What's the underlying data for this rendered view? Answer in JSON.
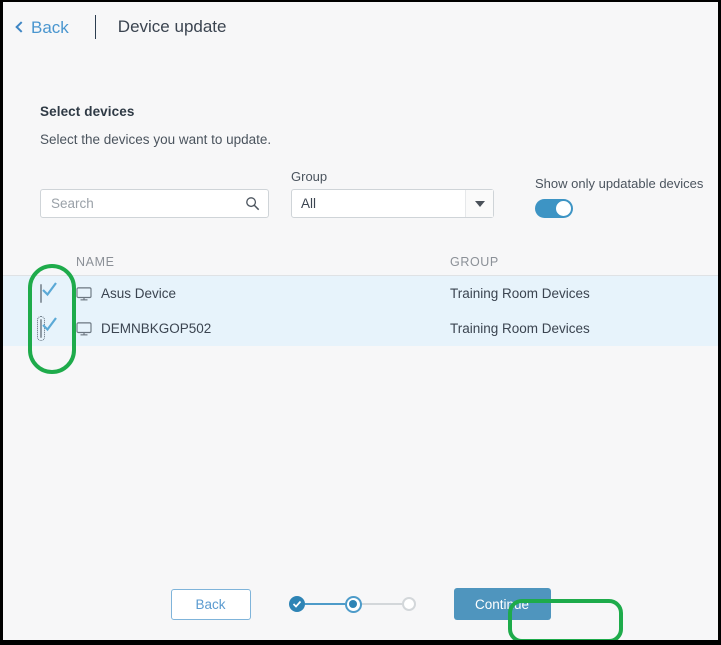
{
  "header": {
    "back_label": "Back",
    "back_icon": "chevron-left-icon",
    "title": "Device update"
  },
  "main": {
    "section_title": "Select devices",
    "section_subtitle": "Select the devices you want to update."
  },
  "filters": {
    "search": {
      "placeholder": "Search",
      "value": "",
      "icon": "search-icon"
    },
    "group": {
      "label": "Group",
      "selected": "All",
      "options": [
        "All"
      ],
      "icon": "chevron-down-icon"
    },
    "updatable_toggle": {
      "label": "Show only updatable devices",
      "state": "on"
    }
  },
  "table": {
    "columns": [
      "NAME",
      "GROUP"
    ],
    "rows": [
      {
        "checked": true,
        "focused": false,
        "icon": "monitor-icon",
        "name": "Asus Device",
        "group": "Training Room Devices"
      },
      {
        "checked": true,
        "focused": true,
        "icon": "monitor-icon",
        "name": "DEMNBKGOP502",
        "group": "Training Room Devices"
      }
    ]
  },
  "footer": {
    "back_label": "Back",
    "continue_label": "Continue",
    "steps": [
      {
        "state": "done"
      },
      {
        "state": "current"
      },
      {
        "state": "todo"
      }
    ]
  },
  "annotations": [
    {
      "name": "checkbox-column-highlight",
      "color": "#1eab4b"
    },
    {
      "name": "continue-button-highlight",
      "color": "#1eab4b"
    }
  ],
  "colors": {
    "accent_blue": "#4f95be",
    "link_blue": "#4a96cf",
    "row_highlight": "#e7f3fb",
    "annotation_green": "#1eab4b",
    "page_bg": "#f7f7f8"
  }
}
